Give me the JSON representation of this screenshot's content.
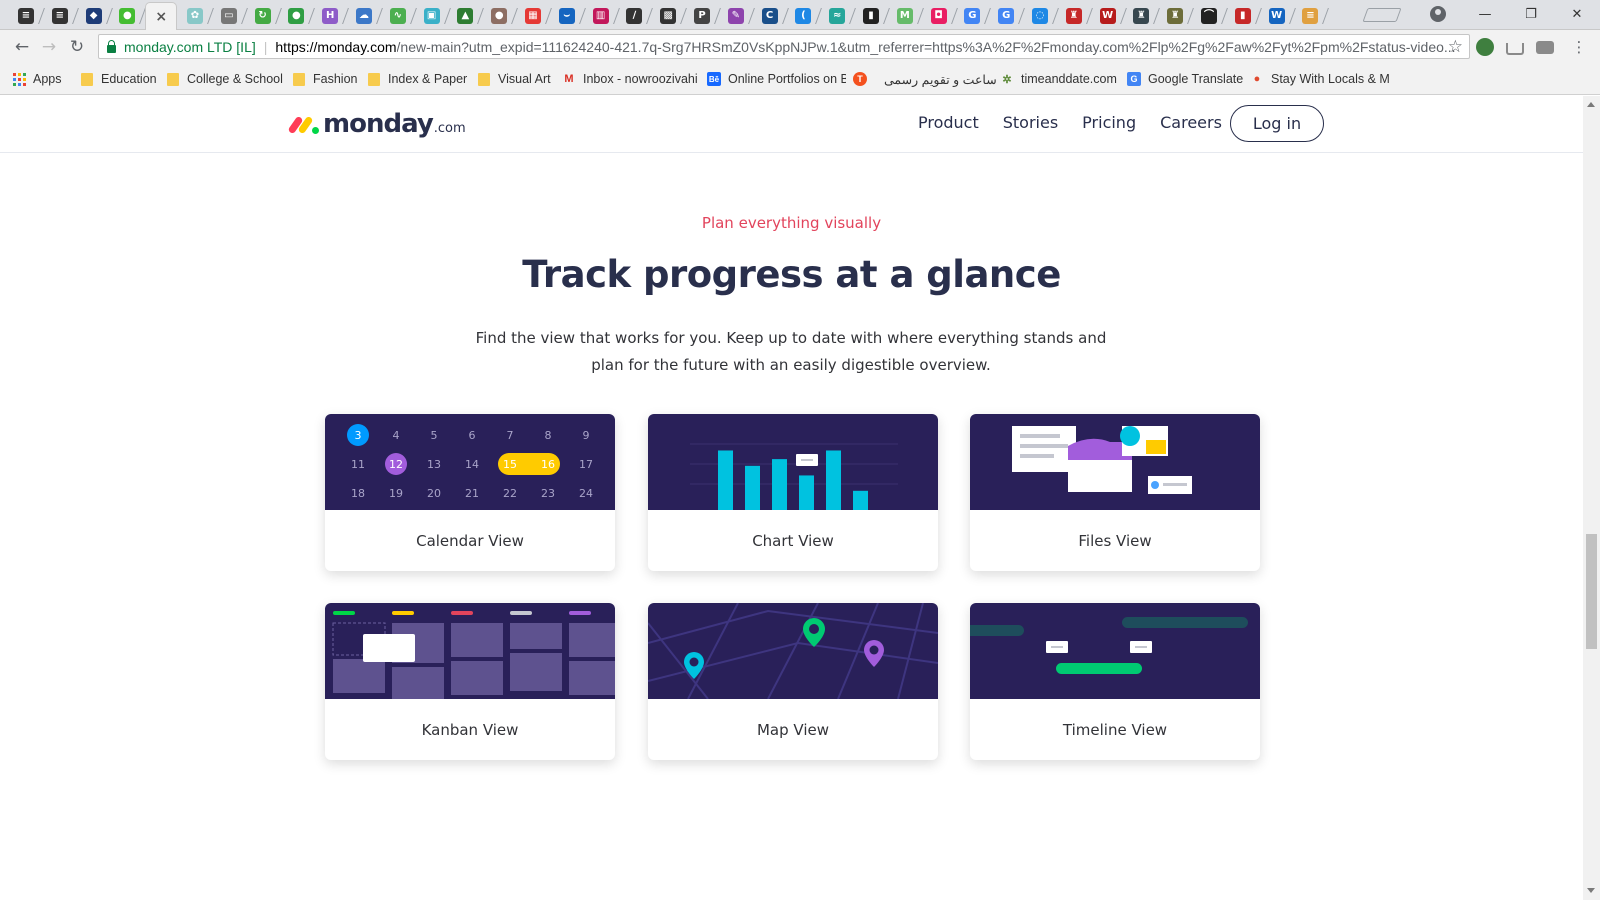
{
  "browser": {
    "tabs": [
      {
        "name": "tab-1",
        "icon": "stack-icon",
        "color": "#333333",
        "glyph": "≡"
      },
      {
        "name": "tab-2",
        "icon": "stack-icon",
        "color": "#333333",
        "glyph": "≡"
      },
      {
        "name": "tab-3",
        "icon": "shield-icon",
        "color": "#1e3c78",
        "glyph": "◆"
      },
      {
        "name": "tab-4",
        "icon": "messenger-icon",
        "color": "#44bd32",
        "glyph": "●"
      },
      {
        "name": "tab-5",
        "icon": "close-icon",
        "color": "#555555",
        "glyph": "×"
      },
      {
        "name": "tab-6",
        "icon": "puzzle-icon",
        "color": "#88c8c8",
        "glyph": "✿"
      },
      {
        "name": "tab-7",
        "icon": "document-icon",
        "color": "#777777",
        "glyph": "▭"
      },
      {
        "name": "tab-8",
        "icon": "refresh-icon",
        "color": "#44aa44",
        "glyph": "↻"
      },
      {
        "name": "tab-9",
        "icon": "globe-icon",
        "color": "#2f9e44",
        "glyph": "●"
      },
      {
        "name": "tab-10",
        "icon": "h-icon",
        "color": "#8e5cc8",
        "glyph": "H"
      },
      {
        "name": "tab-11",
        "icon": "cloud-icon",
        "color": "#3c78c8",
        "glyph": "☁"
      },
      {
        "name": "tab-12",
        "icon": "chart-icon",
        "color": "#4caf50",
        "glyph": "∿"
      },
      {
        "name": "tab-13",
        "icon": "image-icon",
        "color": "#3ab0c8",
        "glyph": "▣"
      },
      {
        "name": "tab-14",
        "icon": "tree-icon",
        "color": "#2e7d32",
        "glyph": "▲"
      },
      {
        "name": "tab-15",
        "icon": "avatar-icon",
        "color": "#8d6e63",
        "glyph": "●"
      },
      {
        "name": "tab-16",
        "icon": "windows-icon",
        "color": "#e53935",
        "glyph": "▦"
      },
      {
        "name": "tab-17",
        "icon": "wave-icon",
        "color": "#1565c0",
        "glyph": "⌣"
      },
      {
        "name": "tab-18",
        "icon": "grid-icon",
        "color": "#c2185b",
        "glyph": "▥"
      },
      {
        "name": "tab-19",
        "icon": "slash-icon",
        "color": "#333333",
        "glyph": "∕"
      },
      {
        "name": "tab-20",
        "icon": "qr-icon",
        "color": "#333333",
        "glyph": "▩"
      },
      {
        "name": "tab-21",
        "icon": "pg-icon",
        "color": "#444444",
        "glyph": "P"
      },
      {
        "name": "tab-22",
        "icon": "pen-icon",
        "color": "#8e44ad",
        "glyph": "✎"
      },
      {
        "name": "tab-23",
        "icon": "c-icon",
        "color": "#1a4f8a",
        "glyph": "C"
      },
      {
        "name": "tab-24",
        "icon": "arc-icon",
        "color": "#1e88e5",
        "glyph": "("
      },
      {
        "name": "tab-25",
        "icon": "wave-icon",
        "color": "#26a69a",
        "glyph": "≈"
      },
      {
        "name": "tab-26",
        "icon": "bookmark-icon",
        "color": "#222222",
        "glyph": "▮"
      },
      {
        "name": "tab-27",
        "icon": "m-icon",
        "color": "#66bb6a",
        "glyph": "M"
      },
      {
        "name": "tab-28",
        "icon": "camera-icon",
        "color": "#e91e63",
        "glyph": "◘"
      },
      {
        "name": "tab-29",
        "icon": "google-icon",
        "color": "#4285f4",
        "glyph": "G"
      },
      {
        "name": "tab-30",
        "icon": "google-icon",
        "color": "#4285f4",
        "glyph": "G"
      },
      {
        "name": "tab-31",
        "icon": "loading-icon",
        "color": "#1e88e5",
        "glyph": "◌"
      },
      {
        "name": "tab-32",
        "icon": "crest-icon",
        "color": "#c62828",
        "glyph": "♜"
      },
      {
        "name": "tab-33",
        "icon": "w-icon",
        "color": "#b71c1c",
        "glyph": "W"
      },
      {
        "name": "tab-34",
        "icon": "crest-icon",
        "color": "#37474f",
        "glyph": "♜"
      },
      {
        "name": "tab-35",
        "icon": "crest-icon",
        "color": "#6d6d3a",
        "glyph": "♜"
      },
      {
        "name": "tab-36",
        "icon": "bird-icon",
        "color": "#222222",
        "glyph": "⌒"
      },
      {
        "name": "tab-37",
        "icon": "bookmark-icon",
        "color": "#c62828",
        "glyph": "▮"
      },
      {
        "name": "tab-38",
        "icon": "w3-icon",
        "color": "#1565c0",
        "glyph": "W"
      },
      {
        "name": "tab-39",
        "icon": "list-icon",
        "color": "#e0a040",
        "glyph": "≡"
      }
    ],
    "active_tab_index": 4,
    "url": {
      "ev_label": "monday.com LTD [IL]",
      "scheme_host": "https://monday.com",
      "rest": "/new-main?utm_expid=111624240-421.7q-Srg7HRSmZ0VsKppNJPw.1&utm_referrer=https%3A%2F%2Fmonday.com%2Flp%2Fg%2Faw%2Fyt%2Fpm%2Fstatus-video..."
    },
    "bookmarks": [
      {
        "name": "bookmark-apps",
        "label": "Apps",
        "icon": "apps-grid-icon"
      },
      {
        "name": "bookmark-education",
        "label": "Education",
        "icon": "folder-icon"
      },
      {
        "name": "bookmark-college-school",
        "label": "College & School",
        "icon": "folder-icon"
      },
      {
        "name": "bookmark-fashion",
        "label": "Fashion",
        "icon": "folder-icon"
      },
      {
        "name": "bookmark-index-paper",
        "label": "Index & Paper",
        "icon": "folder-icon"
      },
      {
        "name": "bookmark-visual-art",
        "label": "Visual Art",
        "icon": "folder-icon"
      },
      {
        "name": "bookmark-inbox",
        "label": "Inbox - nowroozivahi",
        "icon": "gmail-icon"
      },
      {
        "name": "bookmark-online-portfolios",
        "label": "Online Portfolios on B",
        "icon": "behance-icon"
      },
      {
        "name": "bookmark-t",
        "label": "",
        "icon": "t-icon"
      },
      {
        "name": "bookmark-persian-calendar",
        "label": "ساعت و تقویم رسمی",
        "icon": "none"
      },
      {
        "name": "bookmark-timeanddate",
        "label": "timeanddate.com",
        "icon": "dots-icon"
      },
      {
        "name": "bookmark-google-translate",
        "label": "Google Translate",
        "icon": "translate-icon"
      },
      {
        "name": "bookmark-stay-with-locals",
        "label": "Stay With Locals & M",
        "icon": "globe-icon"
      }
    ]
  },
  "site": {
    "logo_word": "monday",
    "logo_tld": ".com",
    "logo_colors": [
      "#ff3d57",
      "#ffcb00",
      "#00d647"
    ],
    "nav": [
      "Product",
      "Stories",
      "Pricing",
      "Careers"
    ],
    "login_label": "Log in"
  },
  "section": {
    "eyebrow": "Plan everything visually",
    "headline": "Track progress at a glance",
    "subhead": "Find the view that works for you. Keep up to date with where everything stands and plan for the future with an easily digestible overview.",
    "accent_color": "#e2445c",
    "card_art_bg": "#292059"
  },
  "cards": [
    {
      "name": "calendar-view-card",
      "label": "Calendar View",
      "art": "calendar"
    },
    {
      "name": "chart-view-card",
      "label": "Chart View",
      "art": "chart"
    },
    {
      "name": "files-view-card",
      "label": "Files View",
      "art": "files"
    },
    {
      "name": "kanban-view-card",
      "label": "Kanban View",
      "art": "kanban"
    },
    {
      "name": "map-view-card",
      "label": "Map View",
      "art": "map"
    },
    {
      "name": "timeline-view-card",
      "label": "Timeline View",
      "art": "timeline"
    }
  ],
  "calendar": {
    "days": [
      [
        "3",
        "4",
        "5",
        "6",
        "7",
        "8",
        "9"
      ],
      [
        "11",
        "12",
        "13",
        "14",
        "15",
        "16",
        "17"
      ],
      [
        "18",
        "19",
        "20",
        "21",
        "22",
        "23",
        "24"
      ]
    ],
    "highlights": {
      "3": "#009aff",
      "12": "#a25ddc",
      "15": "#ffcb00",
      "16": "#ffcb00"
    }
  },
  "chart_bars": [
    0.62,
    0.46,
    0.53,
    0.36,
    0.62,
    0.2
  ]
}
